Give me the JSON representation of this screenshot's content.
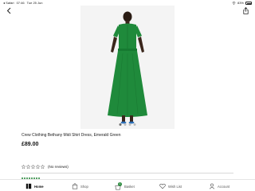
{
  "status_bar": {
    "carrier": "◂ Safari",
    "time": "07:46",
    "date": "Tue 25 Jun",
    "battery": "83%"
  },
  "nav": {
    "back_icon": "chevron-left-icon",
    "share_icon": "share-icon"
  },
  "product": {
    "image_alt_icon": "product-photo",
    "carousel_pages": 4,
    "carousel_active": 0,
    "title": "Crew Clothing Bethany Midi Shirt Dress, Emerald Green",
    "price": "£89.00",
    "dress_color": "#1f8a3b"
  },
  "rating": {
    "stars": 0,
    "max_stars": 5,
    "label": "(No reviews)"
  },
  "tab_bar": {
    "tabs": [
      {
        "label": "Home",
        "icon": "home-icon",
        "active": true
      },
      {
        "label": "Shop",
        "icon": "shop-icon",
        "active": false
      },
      {
        "label": "Basket",
        "icon": "basket-icon",
        "active": false,
        "badge": "1"
      },
      {
        "label": "Wish List",
        "icon": "heart-icon",
        "active": false
      },
      {
        "label": "Account",
        "icon": "account-icon",
        "active": false
      }
    ]
  },
  "colors": {
    "accent_green": "#2b8a3e",
    "text": "#1a1a1a"
  }
}
